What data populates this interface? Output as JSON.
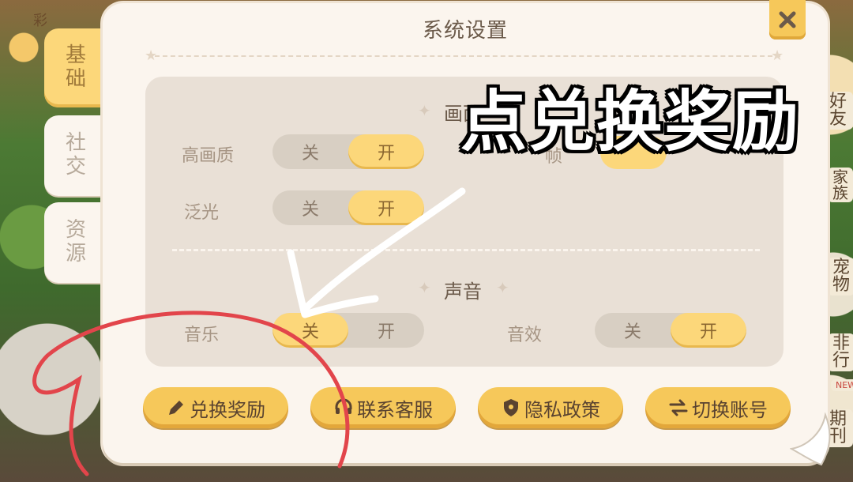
{
  "dialog": {
    "title": "系统设置",
    "close_icon": "close-icon"
  },
  "tabs": [
    {
      "chars": [
        "基",
        "础"
      ],
      "active": true
    },
    {
      "chars": [
        "社",
        "交"
      ],
      "active": false
    },
    {
      "chars": [
        "资",
        "源"
      ],
      "active": false
    }
  ],
  "graphics": {
    "heading": "画面",
    "rows": [
      {
        "label": "高画质",
        "off": "关",
        "on": "开",
        "value": "开"
      },
      {
        "label": "泛光",
        "off": "关",
        "on": "开",
        "value": "开"
      }
    ],
    "partial_label_fragment": "帧"
  },
  "sound": {
    "heading": "声音",
    "music": {
      "label": "音乐",
      "off": "关",
      "on": "开",
      "value": "关"
    },
    "sfx": {
      "label": "音效",
      "off": "关",
      "on": "开",
      "value": "开"
    }
  },
  "buttons": [
    {
      "label": "兑换奖励",
      "icon": "pencil-icon"
    },
    {
      "label": "联系客服",
      "icon": "headset-icon"
    },
    {
      "label": "隐私政策",
      "icon": "shield-icon"
    },
    {
      "label": "切换账号",
      "icon": "switch-arrows-icon"
    }
  ],
  "annotation": {
    "text": "点兑换奖励",
    "arrow_color": "#ffffff",
    "circle_color": "#e2454b"
  },
  "background_labels": {
    "haoyou": "好友",
    "jiazu": "家族",
    "chongwu": "宠物",
    "paihang": "排行",
    "qikan": "期刊",
    "news": "NEWS",
    "caipin": "彩",
    "rank_fragment": "非行"
  },
  "colors": {
    "accent": "#f6c85a",
    "panel": "#fbf5ee",
    "inner": "#e9e0d6"
  }
}
